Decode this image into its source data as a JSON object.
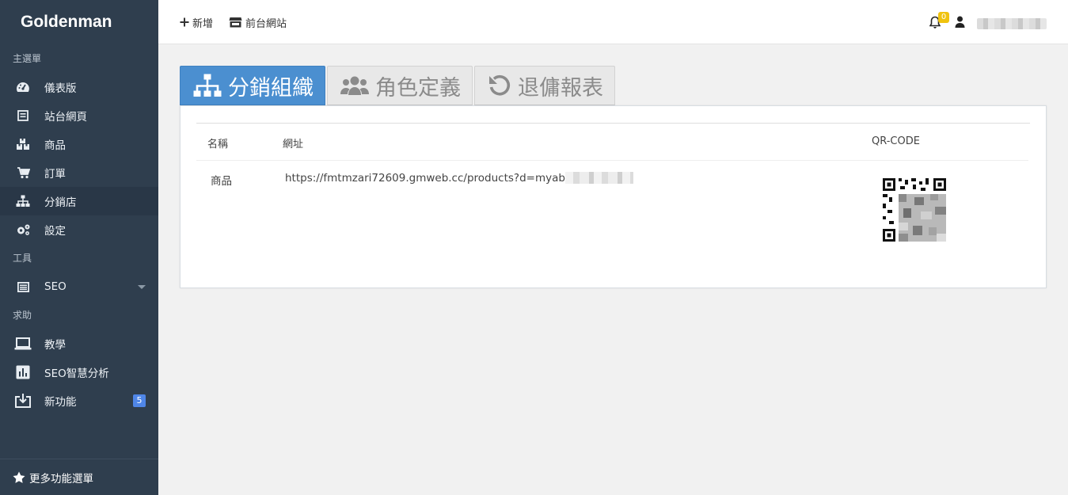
{
  "brand": "Goldenman",
  "sidebar": {
    "sections": [
      "主選單",
      "工具",
      "求助"
    ],
    "items": [
      {
        "label": "儀表版",
        "icon": "dashboard-icon"
      },
      {
        "label": "站台網頁",
        "icon": "file-icon"
      },
      {
        "label": "商品",
        "icon": "boxes-icon"
      },
      {
        "label": "訂單",
        "icon": "cart-icon"
      },
      {
        "label": "分銷店",
        "icon": "sitemap-icon"
      },
      {
        "label": "設定",
        "icon": "gears-icon"
      },
      {
        "label": "SEO",
        "icon": "list-icon"
      },
      {
        "label": "教學",
        "icon": "laptop-icon"
      },
      {
        "label": "SEO智慧分析",
        "icon": "chart-icon"
      },
      {
        "label": "新功能",
        "icon": "download-icon",
        "badge": "5"
      }
    ],
    "more": "更多功能選單"
  },
  "topbar": {
    "add": "新增",
    "storefront": "前台網站",
    "notifications": "0"
  },
  "tabs": [
    "分銷組織",
    "角色定義",
    "退傭報表"
  ],
  "table": {
    "headers": [
      "名稱",
      "網址",
      "QR-CODE"
    ],
    "rows": [
      {
        "name": "商品",
        "url": "https://fmtmzari72609.gmweb.cc/products?d=myabp"
      }
    ]
  },
  "colors": {
    "sidebar": "#2f3e4e",
    "active_tab": "#4b8fd0",
    "badge_blue": "#4f86e8",
    "badge_yellow": "#f0c30f"
  }
}
